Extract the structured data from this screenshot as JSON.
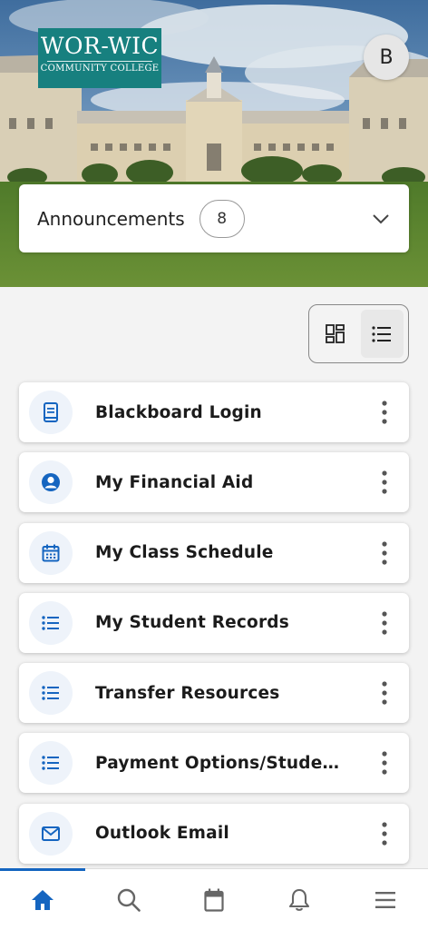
{
  "brand": {
    "logo_line1": "WOR-WIC",
    "logo_line2": "COMMUNITY COLLEGE",
    "accent": "#1565c0",
    "logo_color": "#17807f"
  },
  "user": {
    "initial": "B"
  },
  "announcements": {
    "title": "Announcements",
    "count": "8",
    "icon": "chevron-down-icon"
  },
  "view_toggle": {
    "options": [
      "grid-view-icon",
      "list-view-icon"
    ],
    "selected": "list"
  },
  "items": [
    {
      "label": "Blackboard Login",
      "icon": "book-icon"
    },
    {
      "label": "My Financial Aid",
      "icon": "user-circle-icon"
    },
    {
      "label": "My Class Schedule",
      "icon": "calendar-icon"
    },
    {
      "label": "My Student Records",
      "icon": "list-icon"
    },
    {
      "label": "Transfer Resources",
      "icon": "list-icon"
    },
    {
      "label": "Payment Options/Student F...",
      "icon": "list-icon"
    },
    {
      "label": "Outlook Email",
      "icon": "mail-icon"
    }
  ],
  "nav": [
    {
      "name": "home",
      "icon": "home-icon",
      "active": true
    },
    {
      "name": "search",
      "icon": "search-icon"
    },
    {
      "name": "calendar",
      "icon": "calendar-icon"
    },
    {
      "name": "notifications",
      "icon": "bell-icon"
    },
    {
      "name": "menu",
      "icon": "hamburger-menu-icon"
    }
  ]
}
